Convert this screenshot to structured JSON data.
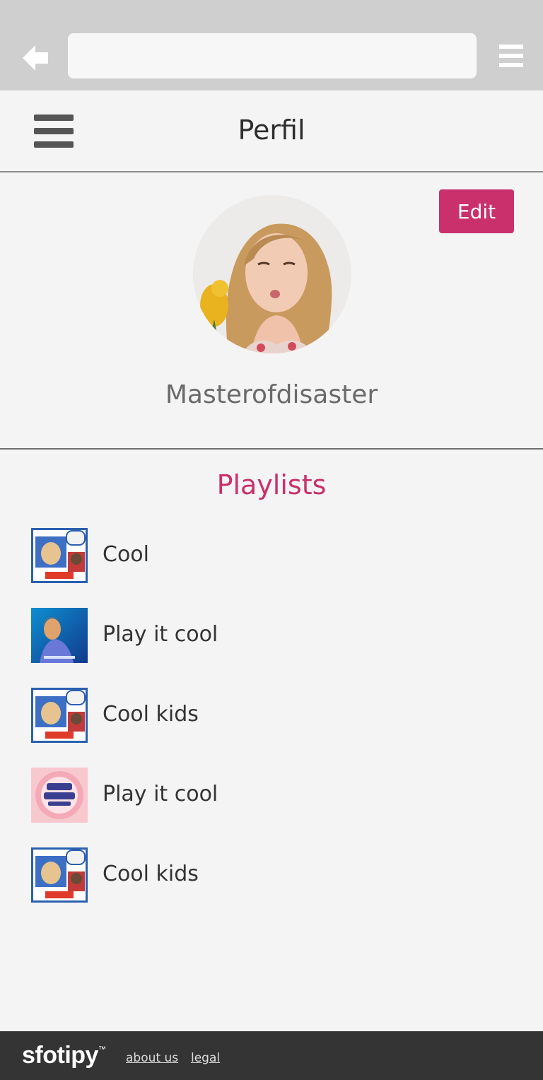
{
  "browser": {
    "address_value": "",
    "back_icon": "back-arrow-icon",
    "menu_icon": "menu-icon"
  },
  "header": {
    "title": "Perfil",
    "menu_icon": "hamburger-icon"
  },
  "profile": {
    "edit_label": "Edit",
    "username": "Masterofdisaster",
    "accent_color": "#c9306c"
  },
  "playlists": {
    "title": "Playlists",
    "items": [
      {
        "name": "Cool",
        "cover": "comic-cover"
      },
      {
        "name": "Play it cool",
        "cover": "blue-cover"
      },
      {
        "name": "Cool kids",
        "cover": "comic-cover"
      },
      {
        "name": "Play it cool",
        "cover": "pink-cover"
      },
      {
        "name": "Cool kids",
        "cover": "comic-cover"
      }
    ]
  },
  "footer": {
    "brand": "sfotipy",
    "brand_mark": "™",
    "links": [
      "about us",
      "legal"
    ]
  }
}
